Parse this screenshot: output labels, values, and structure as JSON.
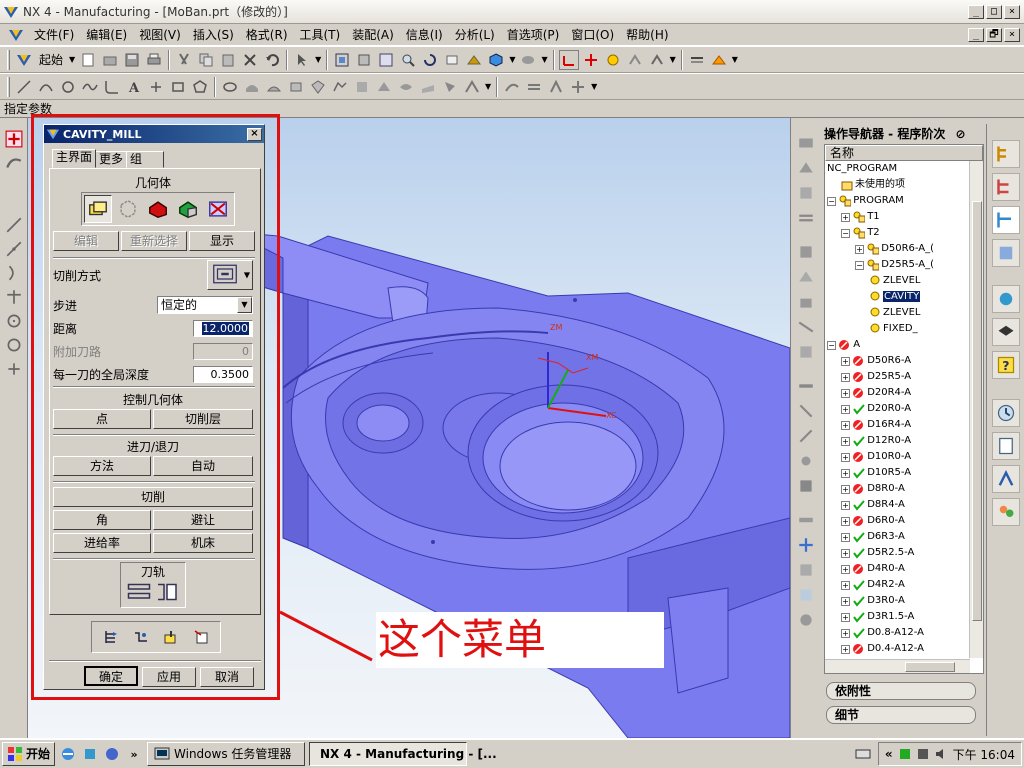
{
  "window": {
    "title": "NX 4 - Manufacturing - [MoBan.prt（修改的）]",
    "controls": [
      "_",
      "□",
      "×"
    ]
  },
  "menubar": {
    "items": [
      "文件(F)",
      "编辑(E)",
      "视图(V)",
      "插入(S)",
      "格式(R)",
      "工具(T)",
      "装配(A)",
      "信息(I)",
      "分析(L)",
      "首选项(P)",
      "窗口(O)",
      "帮助(H)"
    ],
    "doc_controls": [
      "_",
      "🗗",
      "×"
    ]
  },
  "toolbar1": {
    "start_label": "起始"
  },
  "cue_line": "指定参数",
  "dialog": {
    "title": "CAVITY_MILL",
    "close": "×",
    "tabs": [
      "主界面",
      "更多",
      "组"
    ],
    "geometry": {
      "heading": "几何体",
      "edit": "编辑",
      "reselect": "重新选择",
      "display": "显示"
    },
    "cut_method_label": "切削方式",
    "stepover_label": "步进",
    "stepover_value": "恒定的",
    "distance_label": "距离",
    "distance_value": "12.0000",
    "additional_passes_label": "附加刀路",
    "additional_passes_value": "0",
    "global_depth_label": "每一刀的全局深度",
    "global_depth_value": "0.3500",
    "control_geometry": {
      "heading": "控制几何体",
      "point": "点",
      "cut_levels": "切削层"
    },
    "engage_retract": {
      "heading": "进刀/退刀",
      "method": "方法",
      "auto": "自动"
    },
    "cutting": "切削",
    "corner": "角",
    "avoidance": "避让",
    "feedrates": "进给率",
    "machine": "机床",
    "toolpath_heading": "刀轨",
    "ok": "确定",
    "apply": "应用",
    "cancel": "取消"
  },
  "annotation": {
    "callout_text": "这个菜单"
  },
  "navigator": {
    "title": "操作导航器 - 程序阶次",
    "column_header": "名称",
    "tree": [
      {
        "label": "NC_PROGRAM",
        "indent": 0,
        "pm": "",
        "icon": "none"
      },
      {
        "label": "未使用的项",
        "indent": 1,
        "pm": "",
        "icon": "folder"
      },
      {
        "label": "PROGRAM",
        "indent": 0,
        "pm": "−",
        "icon": "bulb-folder"
      },
      {
        "label": "T1",
        "indent": 1,
        "pm": "+",
        "icon": "bulb-folder"
      },
      {
        "label": "T2",
        "indent": 1,
        "pm": "−",
        "icon": "bulb-folder"
      },
      {
        "label": "D50R6-A_(",
        "indent": 2,
        "pm": "+",
        "icon": "bulb-folder"
      },
      {
        "label": "D25R5-A_(",
        "indent": 2,
        "pm": "−",
        "icon": "bulb-folder"
      },
      {
        "label": "ZLEVEL",
        "indent": 3,
        "pm": "",
        "icon": "bulb-op"
      },
      {
        "label": "CAVITY",
        "indent": 3,
        "pm": "",
        "icon": "bulb-op",
        "selected": true
      },
      {
        "label": "ZLEVEL",
        "indent": 3,
        "pm": "",
        "icon": "bulb-op"
      },
      {
        "label": "FIXED_",
        "indent": 3,
        "pm": "",
        "icon": "bulb-op"
      },
      {
        "label": "A",
        "indent": 0,
        "pm": "−",
        "icon": "stop-folder"
      },
      {
        "label": "D50R6-A",
        "indent": 1,
        "pm": "+",
        "icon": "stop-folder"
      },
      {
        "label": "D25R5-A",
        "indent": 1,
        "pm": "+",
        "icon": "stop-folder"
      },
      {
        "label": "D20R4-A",
        "indent": 1,
        "pm": "+",
        "icon": "stop-folder"
      },
      {
        "label": "D20R0-A",
        "indent": 1,
        "pm": "+",
        "icon": "check-folder"
      },
      {
        "label": "D16R4-A",
        "indent": 1,
        "pm": "+",
        "icon": "stop-folder"
      },
      {
        "label": "D12R0-A",
        "indent": 1,
        "pm": "+",
        "icon": "check-folder"
      },
      {
        "label": "D10R0-A",
        "indent": 1,
        "pm": "+",
        "icon": "stop-folder"
      },
      {
        "label": "D10R5-A",
        "indent": 1,
        "pm": "+",
        "icon": "check-folder"
      },
      {
        "label": "D8R0-A",
        "indent": 1,
        "pm": "+",
        "icon": "stop-folder"
      },
      {
        "label": "D8R4-A",
        "indent": 1,
        "pm": "+",
        "icon": "check-folder"
      },
      {
        "label": "D6R0-A",
        "indent": 1,
        "pm": "+",
        "icon": "stop-folder"
      },
      {
        "label": "D6R3-A",
        "indent": 1,
        "pm": "+",
        "icon": "check-folder"
      },
      {
        "label": "D5R2.5-A",
        "indent": 1,
        "pm": "+",
        "icon": "check-folder"
      },
      {
        "label": "D4R0-A",
        "indent": 1,
        "pm": "+",
        "icon": "stop-folder"
      },
      {
        "label": "D4R2-A",
        "indent": 1,
        "pm": "+",
        "icon": "check-folder"
      },
      {
        "label": "D3R0-A",
        "indent": 1,
        "pm": "+",
        "icon": "check-folder"
      },
      {
        "label": "D3R1.5-A",
        "indent": 1,
        "pm": "+",
        "icon": "check-folder"
      },
      {
        "label": "D0.8-A12-A",
        "indent": 1,
        "pm": "+",
        "icon": "check-folder"
      },
      {
        "label": "D0.4-A12-A",
        "indent": 1,
        "pm": "+",
        "icon": "stop-folder"
      }
    ],
    "panel_dependencies": "依附性",
    "panel_details": "细节"
  },
  "taskbar": {
    "start": "开始",
    "quicklaunch_more": "»",
    "tasks": [
      {
        "label": "Windows 任务管理器",
        "active": false
      },
      {
        "label": "NX 4 - Manufacturing - [...",
        "active": true
      }
    ],
    "tray_more": "«",
    "clock": "下午 16:04"
  },
  "colors": {
    "part": "#7b7bf0",
    "annotation_red": "#e01010",
    "selection": "#0a246a"
  }
}
